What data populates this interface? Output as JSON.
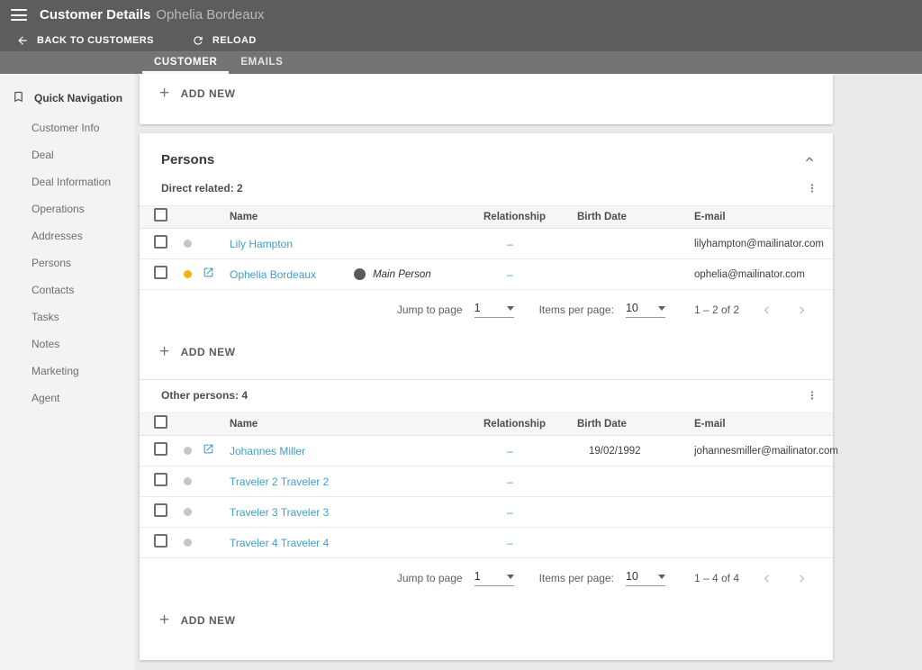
{
  "colors": {
    "appbar_bg": "#5d5d5d",
    "tabbar_bg": "#747474",
    "page_bg": "#eaeaea",
    "sidebar_bg": "#f3f3f3",
    "link_blue": "#3f9fce",
    "status_dot_gray": "#c6c6c6",
    "status_dot_amber": "#f2b50f",
    "main_person_dot": "#5a5a5a"
  },
  "appbar": {
    "title": "Customer Details",
    "subtitle": "Ophelia Bordeaux"
  },
  "toolbar": {
    "back_label": "BACK TO CUSTOMERS",
    "reload_label": "RELOAD"
  },
  "tabs": {
    "customer": "CUSTOMER",
    "emails": "EMAILS"
  },
  "sidebar": {
    "header": "Quick Navigation",
    "items": [
      {
        "label": "Customer Info"
      },
      {
        "label": "Deal"
      },
      {
        "label": "Deal Information"
      },
      {
        "label": "Operations"
      },
      {
        "label": "Addresses"
      },
      {
        "label": "Persons"
      },
      {
        "label": "Contacts"
      },
      {
        "label": "Tasks"
      },
      {
        "label": "Notes"
      },
      {
        "label": "Marketing"
      },
      {
        "label": "Agent"
      }
    ]
  },
  "top_card": {
    "add_new_label": "ADD NEW"
  },
  "persons": {
    "title": "Persons",
    "add_new_label": "ADD NEW",
    "columns": {
      "name": "Name",
      "relationship": "Relationship",
      "birth_date": "Birth Date",
      "email": "E-mail"
    },
    "sections": [
      {
        "heading": "Direct related: 2",
        "rows": [
          {
            "name": "Lily Hampton",
            "relationship": "–",
            "birth_date": "",
            "email": "lilyhampton@mailinator.com"
          },
          {
            "name": "Ophelia Bordeaux",
            "badge": "Main Person",
            "relationship": "–",
            "birth_date": "",
            "email": "ophelia@mailinator.com"
          }
        ],
        "pagination": {
          "jump_label": "Jump to page",
          "page": "1",
          "per_page_label": "Items per page:",
          "per_page": "10",
          "range": "1 – 2 of 2"
        }
      },
      {
        "heading": "Other persons: 4",
        "rows": [
          {
            "name": "Johannes Miller",
            "relationship": "–",
            "birth_date": "19/02/1992",
            "email": "johannesmiller@mailinator.com"
          },
          {
            "name": "Traveler 2 Traveler 2",
            "relationship": "–",
            "birth_date": "",
            "email": ""
          },
          {
            "name": "Traveler 3 Traveler 3",
            "relationship": "–",
            "birth_date": "",
            "email": ""
          },
          {
            "name": "Traveler 4 Traveler 4",
            "relationship": "–",
            "birth_date": "",
            "email": ""
          }
        ],
        "pagination": {
          "jump_label": "Jump to page",
          "page": "1",
          "per_page_label": "Items per page:",
          "per_page": "10",
          "range": "1 – 4 of 4"
        }
      }
    ]
  }
}
